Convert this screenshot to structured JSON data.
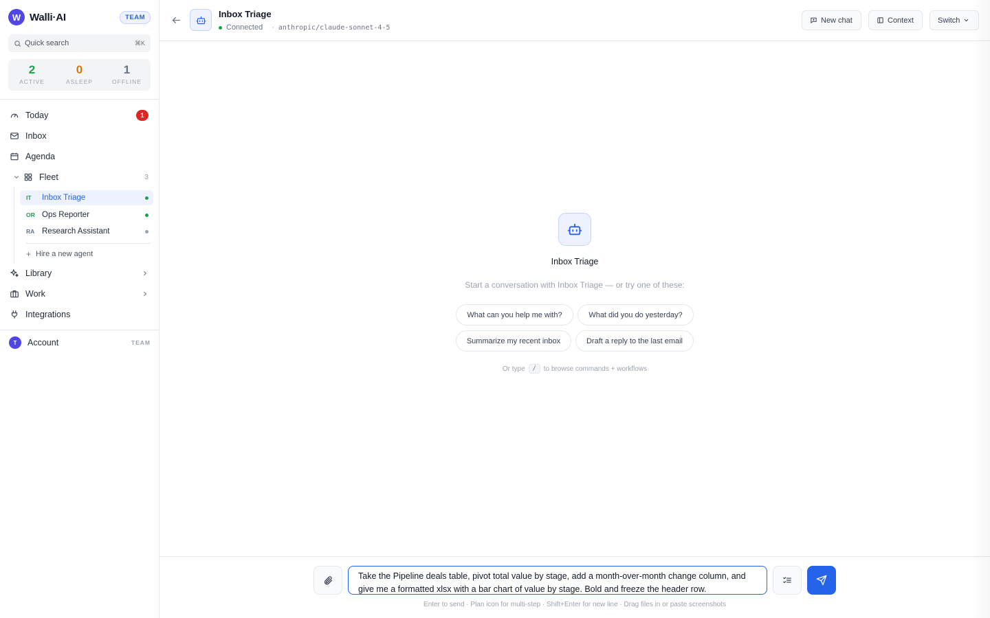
{
  "app": {
    "logo_letter": "W",
    "name": "Walli·AI",
    "plan_badge": "TEAM"
  },
  "search": {
    "placeholder": "Quick search",
    "shortcut": "⌘K"
  },
  "stats": [
    {
      "value": "2",
      "label": "ACTIVE"
    },
    {
      "value": "0",
      "label": "ASLEEP"
    },
    {
      "value": "1",
      "label": "OFFLINE"
    }
  ],
  "nav": {
    "today": {
      "label": "Today",
      "badge": "1"
    },
    "inbox": {
      "label": "Inbox"
    },
    "agenda": {
      "label": "Agenda"
    },
    "fleet": {
      "label": "Fleet",
      "count": "3"
    },
    "library": {
      "label": "Library"
    },
    "work": {
      "label": "Work"
    },
    "integrations": {
      "label": "Integrations"
    }
  },
  "fleet_agents": [
    {
      "abbr": "IT",
      "name": "Inbox Triage",
      "status": "active",
      "status_color": "#16a34a",
      "abbr_color": "#16a34a",
      "selected": true
    },
    {
      "abbr": "OR",
      "name": "Ops Reporter",
      "status": "active",
      "status_color": "#16a34a",
      "abbr_color": "#16a34a",
      "selected": false
    },
    {
      "abbr": "RA",
      "name": "Research Assistant",
      "status": "offline",
      "status_color": "#94a3b8",
      "abbr_color": "#64748b",
      "selected": false
    }
  ],
  "hire_label": "Hire a new agent",
  "account": {
    "avatar_letter": "T",
    "label": "Account",
    "tag": "TEAM"
  },
  "header": {
    "title": "Inbox Triage",
    "status": "Connected",
    "separator": "·",
    "model": "anthropic/claude-sonnet-4-5",
    "buttons": {
      "new_chat": "New chat",
      "context": "Context",
      "switch": "Switch"
    }
  },
  "empty_state": {
    "icon": "robot-icon",
    "title": "Inbox Triage",
    "subtitle": "Start a conversation with Inbox Triage — or try one of these:",
    "suggestions": [
      "What can you help me with?",
      "What did you do yesterday?",
      "Summarize my recent inbox",
      "Draft a reply to the last email"
    ],
    "hint_before": "Or type",
    "hint_key": "/",
    "hint_after": "to browse commands + workflows"
  },
  "composer": {
    "value": "Take the Pipeline deals table, pivot total value by stage, add a month-over-month change column, and give me a formatted xlsx with a bar chart of value by stage. Bold and freeze the header row.",
    "hint": "Enter to send · Plan icon for multi-step · Shift+Enter for new line · Drag files in or paste screenshots"
  },
  "colors": {
    "accent": "#2563eb",
    "brand": "#4f46e5",
    "active": "#16a34a",
    "asleep": "#d97706",
    "offline": "#64748b",
    "alert": "#dc2626"
  }
}
